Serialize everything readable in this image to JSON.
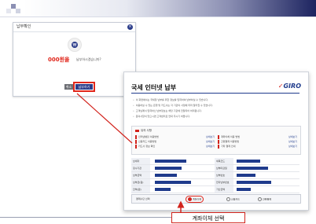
{
  "topbar": {
    "accent_colors": [
      "#1d2460",
      "#8b8fb3",
      "#e7e9f1"
    ]
  },
  "dialog1": {
    "title": "납부확인",
    "amount": "000원을",
    "question": "납부하시겠습니까?",
    "buttons": {
      "cancel": "취소",
      "pay": "납부하기"
    }
  },
  "window": {
    "title": "국세 인터넷 납부",
    "logo": "GIRO",
    "notes": [
      "이 화면에서는 국세청 납부를 위한 정보를 입력하여 납부하실 수 있습니다.",
      "이용하실 수 있는 은행 및 카드사는 각 기관의 사정에 따라 달라질 수 있습니다.",
      "고객님께서 입력하신 납부정보는 해당 기관에 전달되어 처리됩니다.",
      "문의사항이 있으시면 고객센터로 연락 주시기 바랍니다."
    ],
    "info": {
      "heading": "유의 사항",
      "cells": [
        {
          "label": "인터넷뱅킹 이용방법",
          "link": "상세보기"
        },
        {
          "label": "계좌이체 이용 방법",
          "link": "상세보기"
        },
        {
          "label": "신용카드 이용방법",
          "link": "상세보기"
        },
        {
          "label": "간편결제 이용방법",
          "link": "상세보기"
        },
        {
          "label": "카드사 정보 확인",
          "link": "상세보기"
        },
        {
          "label": "기타 결제 안내",
          "link": "상세보기"
        }
      ]
    },
    "form": {
      "rows": [
        [
          "납세자",
          "세목코드"
        ],
        [
          "징수기관",
          "납부마감일"
        ],
        [
          "납부금액",
          "납부번호"
        ],
        [
          "납부금(원)",
          "전자납부번호"
        ],
        [
          "잔액(원)",
          "가산금액"
        ]
      ]
    },
    "select": {
      "label": "결제수단 선택",
      "options": [
        "계좌이체",
        "신용카드",
        "간편결제"
      ],
      "selected": "계좌이체"
    }
  },
  "callout": {
    "label": "계좌이체 선택"
  },
  "colors": {
    "navy": "#1f3b8c",
    "red": "#d2231c"
  }
}
